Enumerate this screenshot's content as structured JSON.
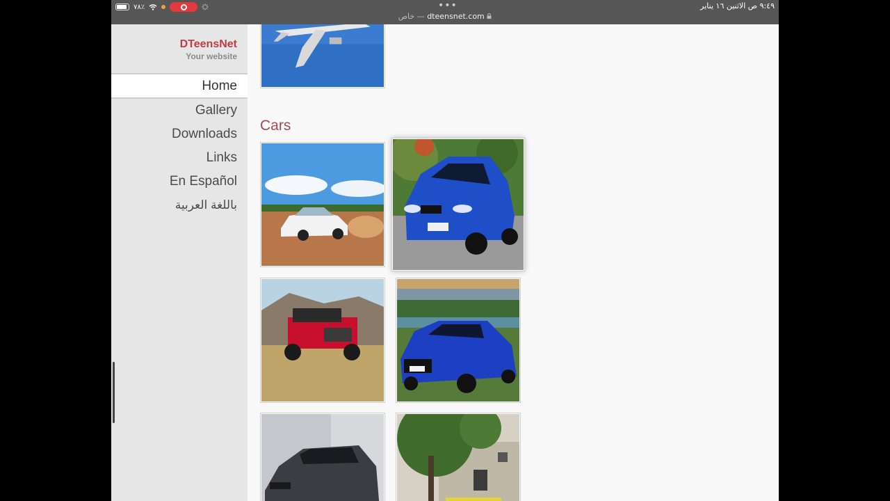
{
  "status_bar": {
    "time_date": "٩:٤٩ ص   الاثنين ١٦ يناير",
    "battery": "٧٨٪",
    "url_prefix": "خاص —",
    "url": "dteensnet.com",
    "more_dots": "•••"
  },
  "site": {
    "title": "DTeensNet",
    "tagline": "Your website"
  },
  "nav": [
    {
      "label": "Home",
      "active": true
    },
    {
      "label": "Gallery"
    },
    {
      "label": "Downloads"
    },
    {
      "label": "Links"
    },
    {
      "label": "En Español"
    },
    {
      "label": "باللغة العربية"
    }
  ],
  "gallery": {
    "section_title": "Cars",
    "images": [
      "airplane-photo",
      "white-bmw-photo",
      "blue-bmw-photo",
      "red-jeep-photo",
      "blue-audi-photo",
      "grey-ford-photo",
      "tree-house-photo"
    ]
  },
  "colors": {
    "brand_red": "#c43b44",
    "section_title": "#a04a55",
    "sidebar_bg": "#e6e6e6",
    "status_bar_bg": "#565656"
  }
}
